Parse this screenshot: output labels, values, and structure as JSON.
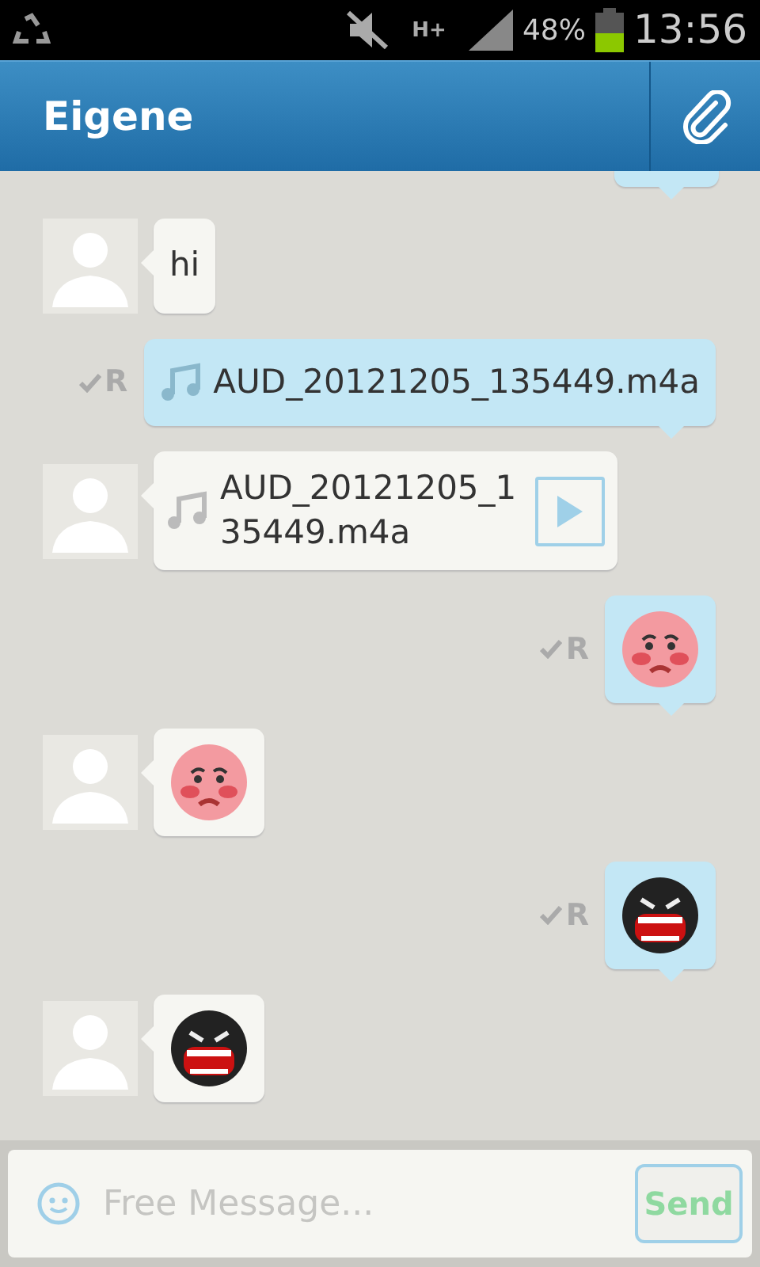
{
  "status_bar": {
    "battery_text": "48%",
    "network": "H+",
    "time": "13:56"
  },
  "header": {
    "title": "Eigene"
  },
  "messages": [
    {
      "outgoing": true,
      "kind": "partial"
    },
    {
      "outgoing": false,
      "kind": "text",
      "text": "hi"
    },
    {
      "outgoing": true,
      "kind": "audio",
      "text": "AUD_20121205_135449.m4a",
      "receipt": "R"
    },
    {
      "outgoing": false,
      "kind": "audio",
      "text": "AUD_20121205_1\n35449.m4a"
    },
    {
      "outgoing": true,
      "kind": "worried",
      "receipt": "R"
    },
    {
      "outgoing": false,
      "kind": "worried"
    },
    {
      "outgoing": true,
      "kind": "biting",
      "receipt": "R"
    },
    {
      "outgoing": false,
      "kind": "biting"
    }
  ],
  "composer": {
    "placeholder": "Free Message...",
    "send": "Send"
  }
}
